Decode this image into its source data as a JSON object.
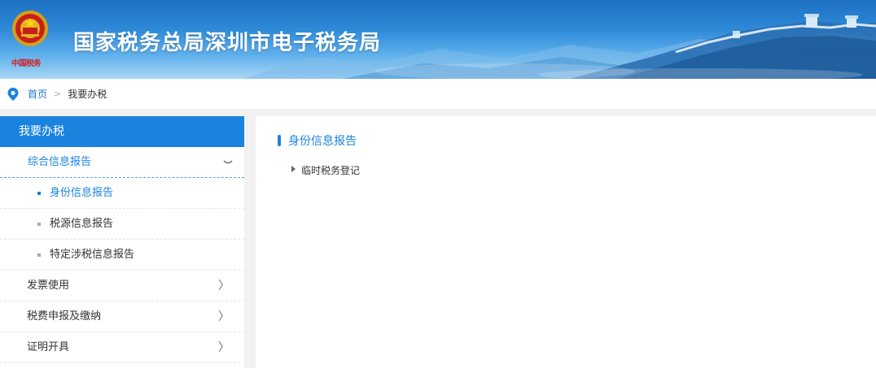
{
  "header": {
    "site_title": "国家税务总局深圳市电子税务局",
    "motto": "中国税务"
  },
  "breadcrumb": {
    "home": "首页",
    "separator": ">",
    "current": "我要办税"
  },
  "sidebar": {
    "title": "我要办税",
    "group": {
      "label": "综合信息报告",
      "items": [
        {
          "label": "身份信息报告",
          "active": true
        },
        {
          "label": "税源信息报告",
          "active": false
        },
        {
          "label": "特定涉税信息报告",
          "active": false
        }
      ]
    },
    "items": [
      {
        "label": "发票使用"
      },
      {
        "label": "税费申报及缴纳"
      },
      {
        "label": "证明开具"
      }
    ],
    "expand_glyph": "〉"
  },
  "main": {
    "section_title": "身份信息报告",
    "links": [
      "临时税务登记"
    ]
  },
  "colors": {
    "accent": "#1a83de",
    "banner_top": "#1e6fc2",
    "banner_bottom": "#a9d6f5",
    "page_bg": "#f1f1f1"
  },
  "icons": {
    "emblem": "national-emblem-icon",
    "breadcrumb": "location-pin-icon",
    "group_toggle": "chevron-down-icon",
    "item_toggle": "chevron-right-icon",
    "link_bullet": "triangle-right-icon"
  }
}
